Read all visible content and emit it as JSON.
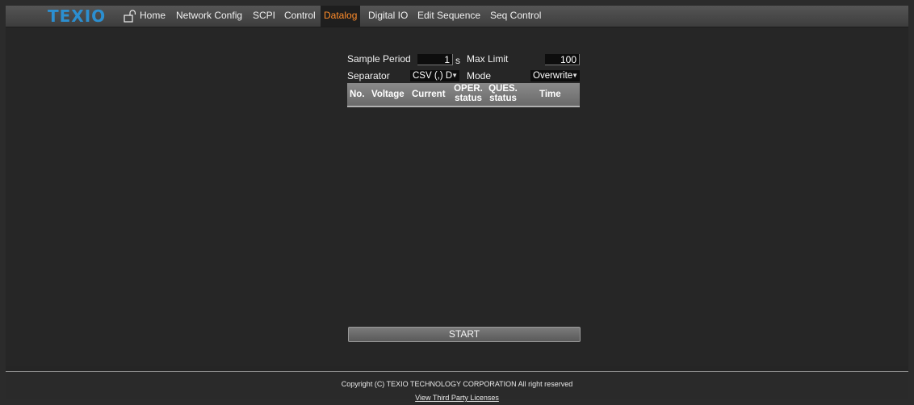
{
  "brand": {
    "logo": "TEXIO",
    "accent_color": "#2c8fd0",
    "active_color": "#ff8c2a"
  },
  "nav": {
    "lock_icon": "unlock-icon",
    "items": [
      {
        "label": "Home"
      },
      {
        "label": "Network Config"
      },
      {
        "label": "SCPI"
      },
      {
        "label": "Control"
      },
      {
        "label": "Datalog",
        "active": true
      },
      {
        "label": "Digital IO"
      },
      {
        "label": "Edit Sequence"
      },
      {
        "label": "Seq Control"
      }
    ]
  },
  "datalog": {
    "sample_period_label": "Sample Period",
    "sample_period_value": "1",
    "sample_period_unit": "s",
    "max_limit_label": "Max Limit",
    "max_limit_value": "100",
    "separator_label": "Separator",
    "separator_value": "CSV (,) D",
    "mode_label": "Mode",
    "mode_value": "Overwrite",
    "table_headers": [
      "No.",
      "Voltage",
      "Current",
      "OPER. status",
      "QUES. status",
      "Time"
    ],
    "start_label": "START"
  },
  "footer": {
    "copyright": "Copyright (C) TEXIO TECHNOLOGY CORPORATION All right reserved",
    "licenses": "View Third Party Licenses"
  }
}
